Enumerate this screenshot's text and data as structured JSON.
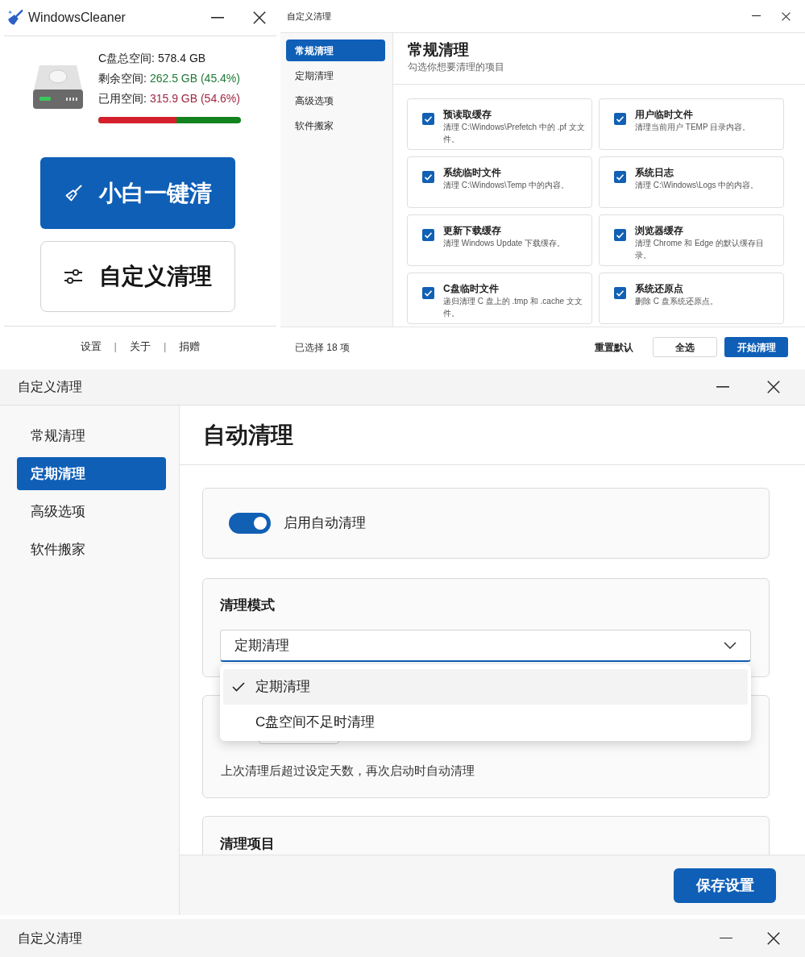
{
  "main_window": {
    "title": "WindowsCleaner",
    "disk": {
      "lines": [
        {
          "label": "C盘总空间:",
          "value": "578.4 GB",
          "color": "#1b1b1b"
        },
        {
          "label": "剩余空间:",
          "value": "262.5 GB (45.4%)",
          "color": "#1f7a36"
        },
        {
          "label": "已用空间:",
          "value": "315.9 GB (54.6%)",
          "color": "#a12643"
        }
      ],
      "level": 0.546
    },
    "buttons": [
      {
        "kind": "primary",
        "label": "小白一键清"
      },
      {
        "kind": "secondary",
        "label": "自定义清理"
      }
    ],
    "footer": [
      {
        "kind": "link",
        "text": "设置"
      },
      {
        "kind": "separator",
        "text": "|"
      },
      {
        "kind": "link",
        "text": "关于"
      },
      {
        "kind": "separator",
        "text": "|"
      },
      {
        "kind": "link",
        "text": "捐赠"
      }
    ]
  },
  "custom_window": {
    "title": "自定义清理",
    "sidebar": [
      {
        "label": "常规清理",
        "selected": true
      },
      {
        "label": "定期清理",
        "selected": false
      },
      {
        "label": "高级选项",
        "selected": false
      },
      {
        "label": "软件搬家",
        "selected": false
      }
    ],
    "heading": "常规清理",
    "subtitle": "勾选你想要清理的项目",
    "items": [
      {
        "title": "预读取缓存",
        "description": "清理 C:\\Windows\\Prefetch 中的 .pf 文文件。",
        "checked": true
      },
      {
        "title": "用户临时文件",
        "description": "清理当前用户 TEMP 目录内容。",
        "checked": true
      },
      {
        "title": "系统临时文件",
        "description": "清理 C:\\Windows\\Temp 中的内容。",
        "checked": true
      },
      {
        "title": "系统日志",
        "description": "清理 C:\\Windows\\Logs 中的内容。",
        "checked": true
      },
      {
        "title": "更新下载缓存",
        "description": "清理 Windows Update 下载缓存。",
        "checked": true
      },
      {
        "title": "浏览器缓存",
        "description": "清理 Chrome 和 Edge 的默认缓存目录。",
        "checked": true
      },
      {
        "title": "C盘临时文件",
        "description": "递归清理 C 盘上的 .tmp 和 .cache 文文件。",
        "checked": true
      },
      {
        "title": "系统还原点",
        "description": "删除 C 盘系统还原点。",
        "checked": true
      }
    ],
    "footer": {
      "count": "已选择 18 项",
      "buttons": [
        {
          "kind": "text",
          "label": "重置默认"
        },
        {
          "kind": "outline",
          "label": "全选"
        },
        {
          "kind": "primary",
          "label": "开始清理"
        }
      ]
    }
  },
  "schedule_window": {
    "title": "自定义清理",
    "sidebar": [
      {
        "label": "常规清理",
        "selected": false
      },
      {
        "label": "定期清理",
        "selected": true
      },
      {
        "label": "高级选项",
        "selected": false
      },
      {
        "label": "软件搬家",
        "selected": false
      }
    ],
    "heading": "自动清理",
    "toggle": {
      "label": "启用自动清理",
      "on": true
    },
    "mode": {
      "label": "清理模式",
      "value": "定期清理",
      "expanded": true,
      "options": [
        {
          "label": "定期清理",
          "selected": true
        },
        {
          "label": "C盘空间不足时清理",
          "selected": false
        }
      ]
    },
    "interval": {
      "hint": "上次清理后超过设定天数，再次启动时自动清理"
    },
    "items_section": {
      "label": "清理项目"
    },
    "save_button": {
      "label": "保存设置"
    }
  },
  "bottom_window": {
    "title": "自定义清理"
  }
}
